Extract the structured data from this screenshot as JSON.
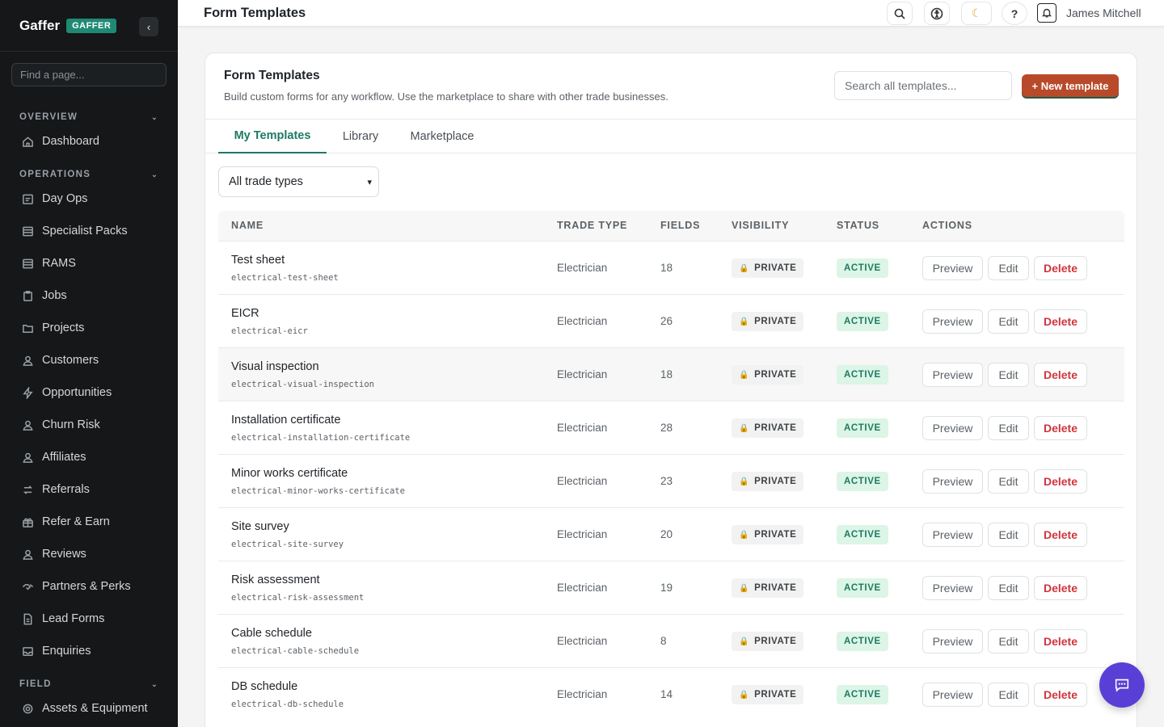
{
  "sidebar": {
    "brand": "Gaffer",
    "badge": "GAFFER",
    "collapse_icon": "chevron-left-icon",
    "find_placeholder": "Find a page...",
    "sections": [
      {
        "label": "OVERVIEW",
        "items": [
          {
            "label": "Dashboard",
            "icon": "home-icon"
          }
        ]
      },
      {
        "label": "OPERATIONS",
        "items": [
          {
            "label": "Day Ops",
            "icon": "calendar-icon"
          },
          {
            "label": "Specialist Packs",
            "icon": "list-icon"
          },
          {
            "label": "RAMS",
            "icon": "list-icon"
          },
          {
            "label": "Jobs",
            "icon": "clipboard-icon"
          },
          {
            "label": "Projects",
            "icon": "folder-icon"
          },
          {
            "label": "Customers",
            "icon": "user-icon"
          },
          {
            "label": "Opportunities",
            "icon": "bolt-icon"
          },
          {
            "label": "Churn Risk",
            "icon": "user-icon"
          },
          {
            "label": "Affiliates",
            "icon": "users-icon"
          },
          {
            "label": "Referrals",
            "icon": "swap-icon"
          },
          {
            "label": "Refer & Earn",
            "icon": "gift-icon"
          },
          {
            "label": "Reviews",
            "icon": "user-icon"
          },
          {
            "label": "Partners & Perks",
            "icon": "handshake-icon"
          },
          {
            "label": "Lead Forms",
            "icon": "document-icon"
          },
          {
            "label": "Enquiries",
            "icon": "inbox-icon"
          }
        ]
      },
      {
        "label": "FIELD",
        "items": [
          {
            "label": "Assets & Equipment",
            "icon": "gear-icon"
          }
        ]
      }
    ]
  },
  "topbar": {
    "title": "Form Templates",
    "user": "James Mitchell",
    "help": "?"
  },
  "main": {
    "title": "Form Templates",
    "subtitle": "Build custom forms for any workflow. Use the marketplace to share with other trade businesses.",
    "search_placeholder": "Search all templates...",
    "new_button": "+ New template",
    "tabs": [
      "My Templates",
      "Library",
      "Marketplace"
    ],
    "active_tab": "My Templates",
    "filter_value": "All trade types",
    "columns": [
      "NAME",
      "TRADE TYPE",
      "FIELDS",
      "VISIBILITY",
      "STATUS",
      "ACTIONS"
    ],
    "actions": {
      "preview": "Preview",
      "edit": "Edit",
      "delete": "Delete"
    },
    "rows": [
      {
        "name": "Test sheet",
        "slug": "electrical-test-sheet",
        "trade": "Electrician",
        "fields": "18",
        "visibility": "PRIVATE",
        "status": "ACTIVE"
      },
      {
        "name": "EICR",
        "slug": "electrical-eicr",
        "trade": "Electrician",
        "fields": "26",
        "visibility": "PRIVATE",
        "status": "ACTIVE"
      },
      {
        "name": "Visual inspection",
        "slug": "electrical-visual-inspection",
        "trade": "Electrician",
        "fields": "18",
        "visibility": "PRIVATE",
        "status": "ACTIVE"
      },
      {
        "name": "Installation certificate",
        "slug": "electrical-installation-certificate",
        "trade": "Electrician",
        "fields": "28",
        "visibility": "PRIVATE",
        "status": "ACTIVE"
      },
      {
        "name": "Minor works certificate",
        "slug": "electrical-minor-works-certificate",
        "trade": "Electrician",
        "fields": "23",
        "visibility": "PRIVATE",
        "status": "ACTIVE"
      },
      {
        "name": "Site survey",
        "slug": "electrical-site-survey",
        "trade": "Electrician",
        "fields": "20",
        "visibility": "PRIVATE",
        "status": "ACTIVE"
      },
      {
        "name": "Risk assessment",
        "slug": "electrical-risk-assessment",
        "trade": "Electrician",
        "fields": "19",
        "visibility": "PRIVATE",
        "status": "ACTIVE"
      },
      {
        "name": "Cable schedule",
        "slug": "electrical-cable-schedule",
        "trade": "Electrician",
        "fields": "8",
        "visibility": "PRIVATE",
        "status": "ACTIVE"
      },
      {
        "name": "DB schedule",
        "slug": "electrical-db-schedule",
        "trade": "Electrician",
        "fields": "14",
        "visibility": "PRIVATE",
        "status": "ACTIVE"
      }
    ]
  },
  "colors": {
    "accent": "#1d7a63",
    "brand_badge": "#1f8a74",
    "new_button": "#b84a2a",
    "delete": "#d1343d",
    "fab": "#5a3fd6",
    "sidebar_bg": "#151718"
  }
}
